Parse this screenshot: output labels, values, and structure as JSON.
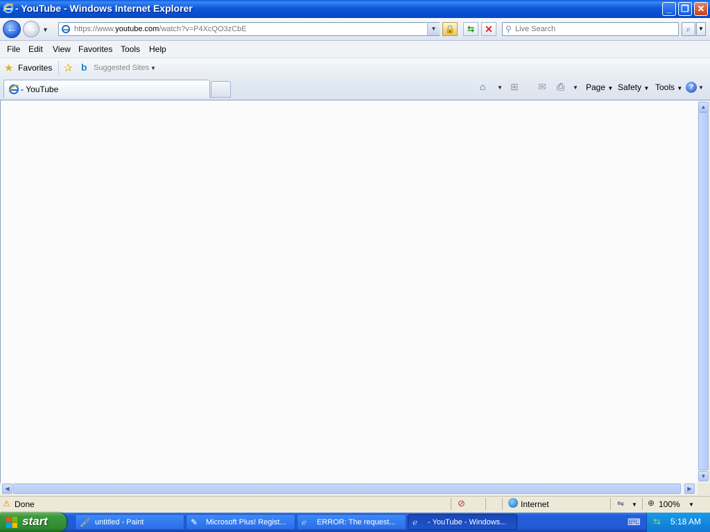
{
  "window": {
    "title": "- YouTube - Windows Internet Explorer",
    "accent": "#0a58d8"
  },
  "address_bar": {
    "url_prefix": "https://www.",
    "url_domain": "youtube.com",
    "url_path": "/watch?v=P4XcQO3zCbE",
    "search_placeholder": "Live Search"
  },
  "menu": [
    "File",
    "Edit",
    "View",
    "Favorites",
    "Tools",
    "Help"
  ],
  "favorites_bar": {
    "favorites_label": "Favorites",
    "suggested_label": "Suggested Sites"
  },
  "tabs": [
    {
      "label": "- YouTube",
      "active": true
    }
  ],
  "command_bar": {
    "page": "Page",
    "safety": "Safety",
    "tools": "Tools"
  },
  "status_bar": {
    "text": "Done",
    "zone": "Internet",
    "zoom": "100%"
  },
  "taskbar": {
    "start_label": "start",
    "tasks": [
      {
        "label": "untitled - Paint",
        "icon": "paint-icon",
        "active": false
      },
      {
        "label": "Microsoft Plus! Regist...",
        "icon": "registration-icon",
        "active": false
      },
      {
        "label": "ERROR: The request...",
        "icon": "ie-icon",
        "active": false
      },
      {
        "label": "- YouTube - Windows...",
        "icon": "ie-icon",
        "active": true
      }
    ],
    "clock": "5:18 AM"
  }
}
